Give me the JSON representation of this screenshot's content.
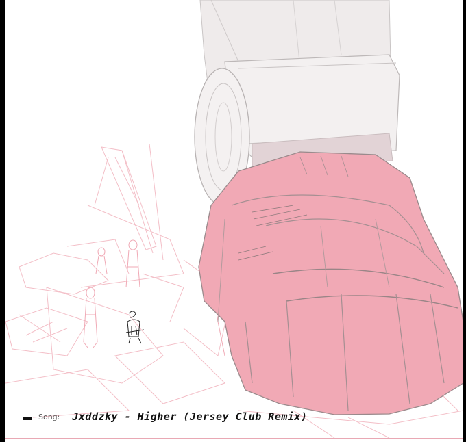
{
  "caption": {
    "label": "Song:",
    "title": "Jxddzky - Higher (Jersey Club Remix)"
  },
  "colors": {
    "background": "#000000",
    "canvas": "#ffffff",
    "foot_pink": "#f1aab6",
    "shin_gray": "#eeeaea",
    "sketch_line": "#f0b6bf",
    "ink_line": "#8a8a8a"
  },
  "icons": [
    "small-figure-sketch",
    "giant-foot-sketch"
  ]
}
